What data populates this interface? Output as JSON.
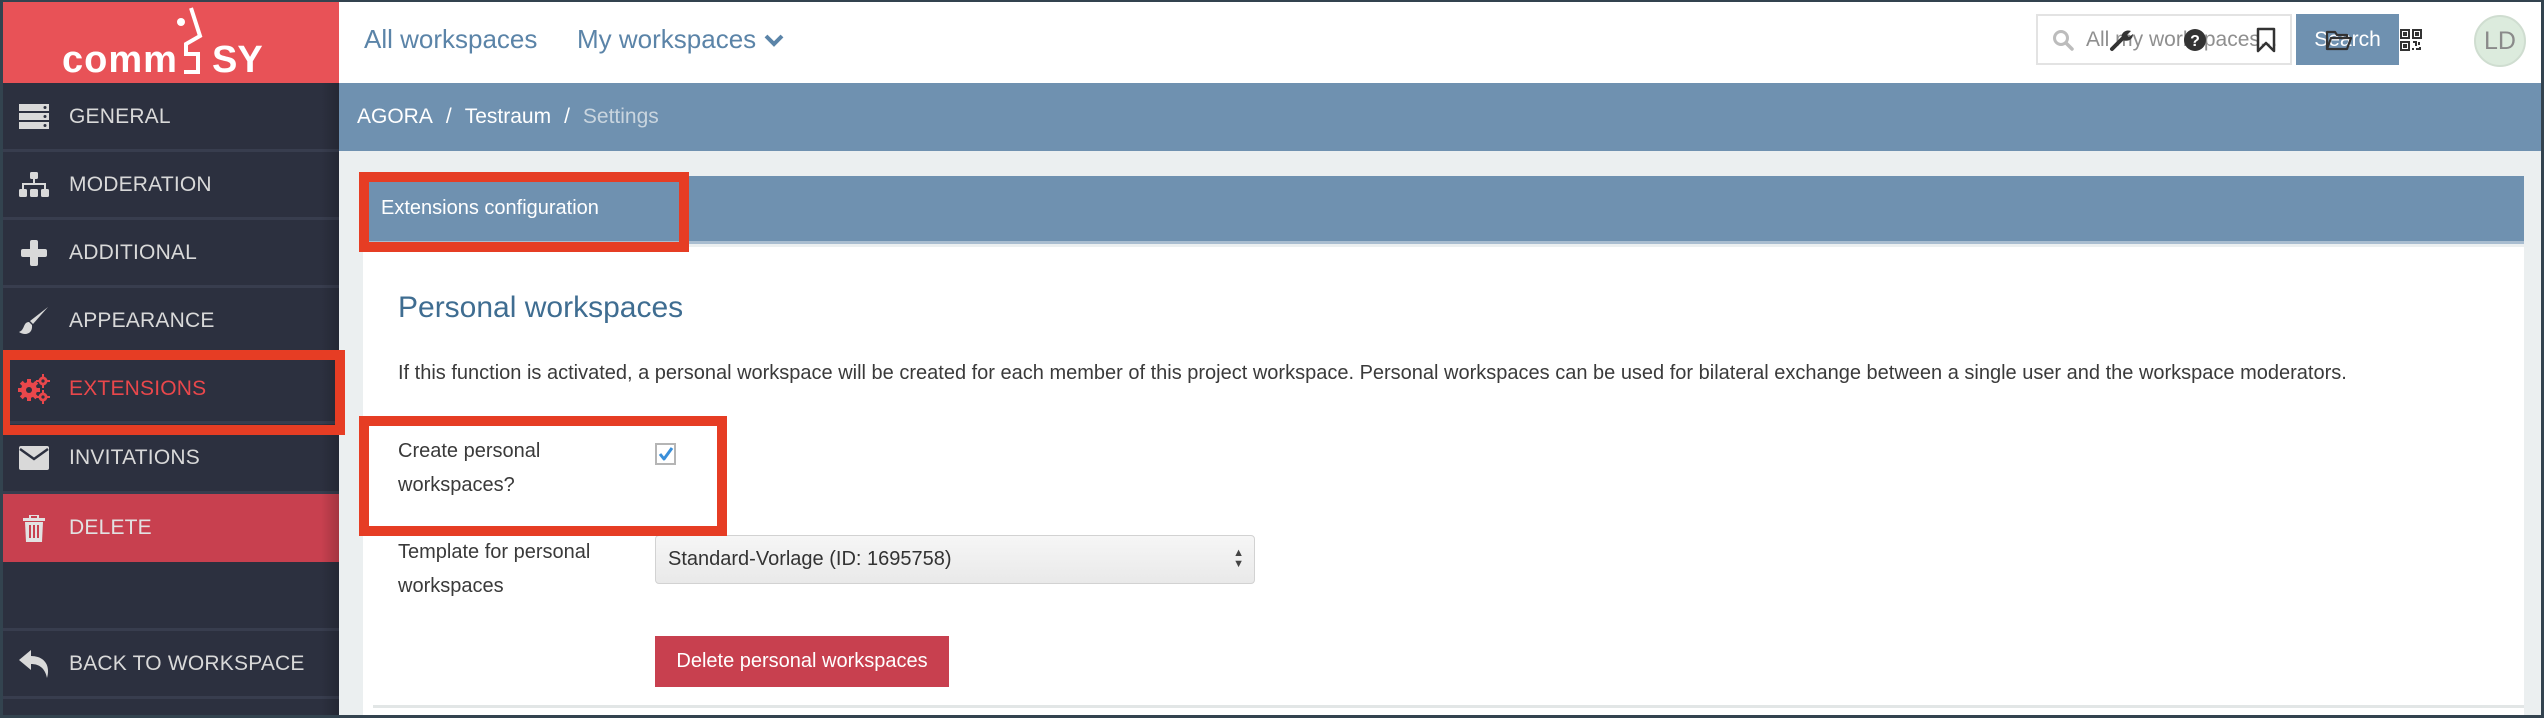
{
  "app": {
    "logo_text": "commsy"
  },
  "sidebar": {
    "items": [
      {
        "label": "GENERAL",
        "icon": "server-icon"
      },
      {
        "label": "MODERATION",
        "icon": "sitemap-icon"
      },
      {
        "label": "ADDITIONAL",
        "icon": "plus-icon"
      },
      {
        "label": "APPEARANCE",
        "icon": "paintbrush-icon"
      },
      {
        "label": "EXTENSIONS",
        "icon": "gears-icon",
        "active": true
      },
      {
        "label": "INVITATIONS",
        "icon": "envelope-icon"
      },
      {
        "label": "DELETE",
        "icon": "trash-icon"
      }
    ],
    "back": {
      "label": "BACK TO WORKSPACE",
      "icon": "reply-icon"
    }
  },
  "topbar": {
    "all_workspaces": "All workspaces",
    "my_workspaces": "My workspaces",
    "search_placeholder": "All my workspaces...",
    "search_button": "Search",
    "tools": [
      "wrench-icon",
      "help-icon",
      "bookmark-icon",
      "folder-open-icon",
      "qrcode-icon"
    ],
    "avatar_initials": "LD"
  },
  "breadcrumb": [
    "AGORA",
    "Testraum",
    "Settings"
  ],
  "panel": {
    "title": "Extensions configuration",
    "section_title": "Personal workspaces",
    "description": "If this function is activated, a personal workspace will be created for each member of this project workspace. Personal workspaces can be used for bilateral exchange between a single user and the workspace moderators.",
    "create_label_line1": "Create personal",
    "create_label_line2": "workspaces?",
    "create_checked": true,
    "template_label_line1": "Template for personal",
    "template_label_line2": "workspaces",
    "template_selected": "Standard-Vorlage (ID: 1695758)",
    "delete_button": "Delete personal workspaces"
  },
  "colors": {
    "brand_red": "#e85257",
    "sidebar_bg": "#2c303f",
    "accent_blue": "#6f91b0",
    "danger": "#c8404f",
    "annotation_red": "#e63d24"
  }
}
